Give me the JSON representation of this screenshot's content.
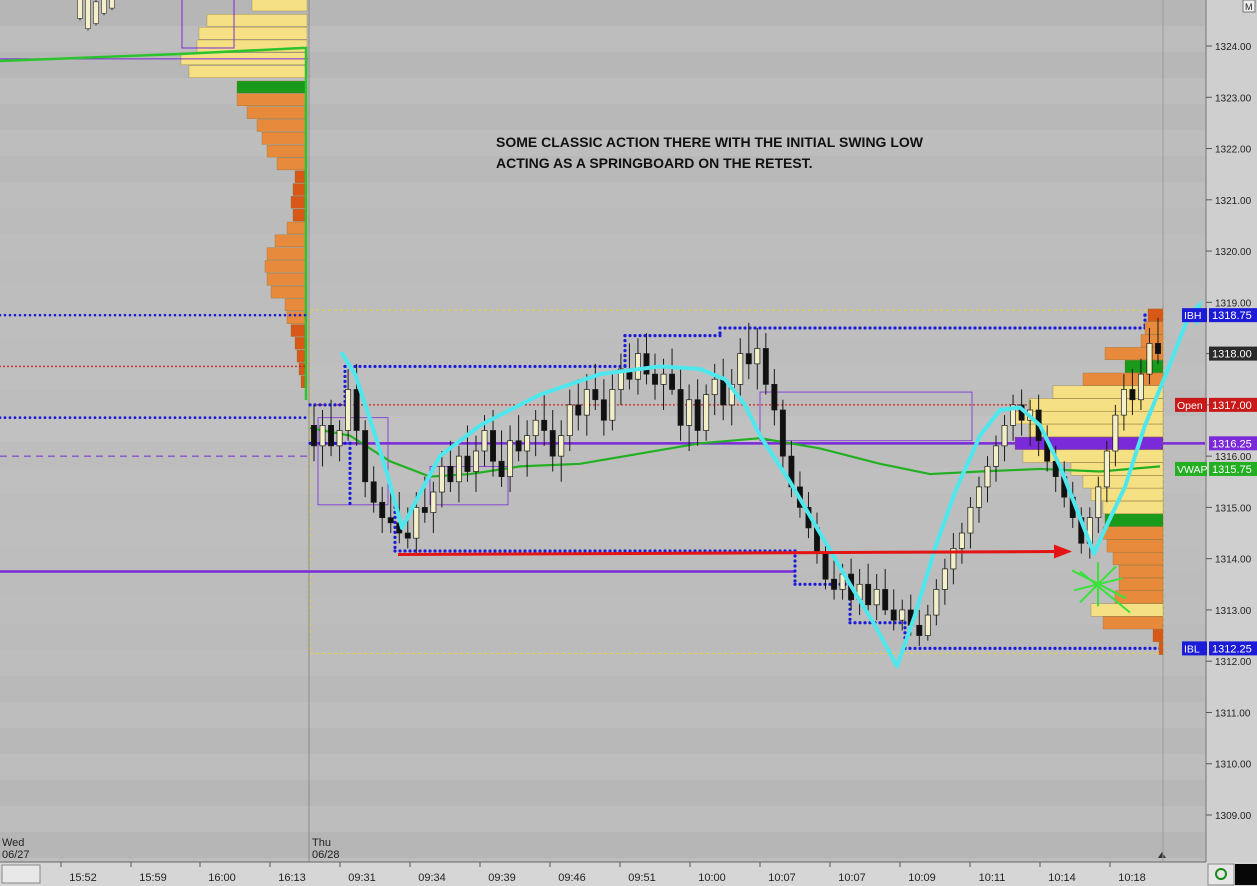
{
  "chart_data": {
    "type": "candlestick",
    "y_axis": {
      "ylim": [
        1308.6,
        1324.6
      ],
      "ticks": [
        "1309.00",
        "1310.00",
        "1311.00",
        "1312.00",
        "1313.00",
        "1314.00",
        "1315.00",
        "1316.00",
        "1317.00",
        "1318.00",
        "1319.00",
        "1320.00",
        "1321.00",
        "1322.00",
        "1323.00",
        "1324.00"
      ],
      "corner_label": "M"
    },
    "x_axis": {
      "session_markers": [
        {
          "day": "Wed",
          "date": "06/27"
        },
        {
          "day": "Thu",
          "date": "06/28"
        }
      ],
      "time_labels": [
        "15:52",
        "15:59",
        "16:00",
        "16:13",
        "09:31",
        "09:34",
        "09:39",
        "09:46",
        "09:51",
        "10:00",
        "10:07",
        "10:07",
        "10:09",
        "10:11",
        "10:14",
        "10:18"
      ]
    },
    "annotation": {
      "line1": "SOME CLASSIC ACTION THERE WITH THE INITIAL SWING LOW",
      "line2": "ACTING AS A SPRINGBOARD ON THE RETEST."
    },
    "price_tags": [
      {
        "text": "IBH",
        "value": "1318.75",
        "price": 1318.75,
        "color": "#1c1cd8"
      },
      {
        "text": "",
        "value": "1318.00",
        "price": 1318.0,
        "color": "#2a2a2a"
      },
      {
        "text": "Open",
        "value": "1317.00",
        "price": 1317.0,
        "color": "#c81818"
      },
      {
        "text": "",
        "value": "1316.25",
        "price": 1316.25,
        "color": "#7a2ad8"
      },
      {
        "text": "VWAP",
        "value": "1315.75",
        "price": 1315.75,
        "color": "#22b022"
      },
      {
        "text": "IBL",
        "value": "1312.25",
        "price": 1312.25,
        "color": "#1c1cd8"
      }
    ],
    "levels": {
      "ibh": 1318.75,
      "ibl": 1312.25,
      "open": 1317.0,
      "purple_line": 1316.25,
      "prior_purple_line": 1313.75,
      "initial_swing_low": 1314.1
    },
    "candles": [
      {
        "o": 1316.6,
        "h": 1317.0,
        "l": 1315.9,
        "c": 1316.2
      },
      {
        "o": 1316.2,
        "h": 1316.9,
        "l": 1315.8,
        "c": 1316.6
      },
      {
        "o": 1316.6,
        "h": 1317.1,
        "l": 1316.0,
        "c": 1316.2
      },
      {
        "o": 1316.2,
        "h": 1316.7,
        "l": 1315.9,
        "c": 1316.5
      },
      {
        "o": 1316.5,
        "h": 1317.7,
        "l": 1316.3,
        "c": 1317.3
      },
      {
        "o": 1317.3,
        "h": 1317.8,
        "l": 1316.2,
        "c": 1316.5
      },
      {
        "o": 1316.5,
        "h": 1316.7,
        "l": 1315.2,
        "c": 1315.5
      },
      {
        "o": 1315.5,
        "h": 1315.8,
        "l": 1314.9,
        "c": 1315.1
      },
      {
        "o": 1315.1,
        "h": 1315.4,
        "l": 1314.5,
        "c": 1314.8
      },
      {
        "o": 1314.8,
        "h": 1315.4,
        "l": 1314.5,
        "c": 1314.7
      },
      {
        "o": 1314.7,
        "h": 1315.3,
        "l": 1314.3,
        "c": 1314.5
      },
      {
        "o": 1314.5,
        "h": 1315.0,
        "l": 1314.2,
        "c": 1314.4
      },
      {
        "o": 1314.4,
        "h": 1315.3,
        "l": 1314.1,
        "c": 1315.0
      },
      {
        "o": 1315.0,
        "h": 1315.6,
        "l": 1314.7,
        "c": 1314.9
      },
      {
        "o": 1314.9,
        "h": 1315.5,
        "l": 1314.5,
        "c": 1315.3
      },
      {
        "o": 1315.3,
        "h": 1316.1,
        "l": 1315.0,
        "c": 1315.8
      },
      {
        "o": 1315.8,
        "h": 1316.3,
        "l": 1315.3,
        "c": 1315.5
      },
      {
        "o": 1315.5,
        "h": 1316.2,
        "l": 1315.1,
        "c": 1316.0
      },
      {
        "o": 1316.0,
        "h": 1316.6,
        "l": 1315.5,
        "c": 1315.7
      },
      {
        "o": 1315.7,
        "h": 1316.4,
        "l": 1315.3,
        "c": 1316.1
      },
      {
        "o": 1316.1,
        "h": 1316.8,
        "l": 1315.8,
        "c": 1316.5
      },
      {
        "o": 1316.5,
        "h": 1316.9,
        "l": 1315.6,
        "c": 1315.9
      },
      {
        "o": 1315.9,
        "h": 1316.5,
        "l": 1315.4,
        "c": 1315.6
      },
      {
        "o": 1315.6,
        "h": 1316.6,
        "l": 1315.3,
        "c": 1316.3
      },
      {
        "o": 1316.3,
        "h": 1316.8,
        "l": 1315.9,
        "c": 1316.1
      },
      {
        "o": 1316.1,
        "h": 1316.7,
        "l": 1315.6,
        "c": 1316.4
      },
      {
        "o": 1316.4,
        "h": 1316.9,
        "l": 1316.0,
        "c": 1316.7
      },
      {
        "o": 1316.7,
        "h": 1317.2,
        "l": 1316.2,
        "c": 1316.5
      },
      {
        "o": 1316.5,
        "h": 1316.9,
        "l": 1315.7,
        "c": 1316.0
      },
      {
        "o": 1316.0,
        "h": 1316.7,
        "l": 1315.5,
        "c": 1316.4
      },
      {
        "o": 1316.4,
        "h": 1317.3,
        "l": 1316.1,
        "c": 1317.0
      },
      {
        "o": 1317.0,
        "h": 1317.5,
        "l": 1316.5,
        "c": 1316.8
      },
      {
        "o": 1316.8,
        "h": 1317.6,
        "l": 1316.4,
        "c": 1317.3
      },
      {
        "o": 1317.3,
        "h": 1317.8,
        "l": 1316.9,
        "c": 1317.1
      },
      {
        "o": 1317.1,
        "h": 1317.5,
        "l": 1316.4,
        "c": 1316.7
      },
      {
        "o": 1316.7,
        "h": 1317.6,
        "l": 1316.5,
        "c": 1317.3
      },
      {
        "o": 1317.3,
        "h": 1318.0,
        "l": 1317.0,
        "c": 1317.7
      },
      {
        "o": 1317.7,
        "h": 1318.2,
        "l": 1317.3,
        "c": 1317.5
      },
      {
        "o": 1317.5,
        "h": 1318.3,
        "l": 1317.2,
        "c": 1318.0
      },
      {
        "o": 1318.0,
        "h": 1318.4,
        "l": 1317.4,
        "c": 1317.6
      },
      {
        "o": 1317.6,
        "h": 1318.0,
        "l": 1317.1,
        "c": 1317.4
      },
      {
        "o": 1317.4,
        "h": 1317.9,
        "l": 1316.9,
        "c": 1317.6
      },
      {
        "o": 1317.6,
        "h": 1318.1,
        "l": 1317.2,
        "c": 1317.3
      },
      {
        "o": 1317.3,
        "h": 1317.7,
        "l": 1316.3,
        "c": 1316.6
      },
      {
        "o": 1316.6,
        "h": 1317.4,
        "l": 1316.1,
        "c": 1317.1
      },
      {
        "o": 1317.1,
        "h": 1317.5,
        "l": 1316.2,
        "c": 1316.5
      },
      {
        "o": 1316.5,
        "h": 1317.4,
        "l": 1316.3,
        "c": 1317.2
      },
      {
        "o": 1317.2,
        "h": 1317.8,
        "l": 1316.8,
        "c": 1317.5
      },
      {
        "o": 1317.5,
        "h": 1317.9,
        "l": 1316.7,
        "c": 1317.0
      },
      {
        "o": 1317.0,
        "h": 1317.7,
        "l": 1316.6,
        "c": 1317.4
      },
      {
        "o": 1317.4,
        "h": 1318.3,
        "l": 1317.1,
        "c": 1318.0
      },
      {
        "o": 1318.0,
        "h": 1318.6,
        "l": 1317.5,
        "c": 1317.8
      },
      {
        "o": 1317.8,
        "h": 1318.5,
        "l": 1317.3,
        "c": 1318.1
      },
      {
        "o": 1318.1,
        "h": 1318.4,
        "l": 1317.2,
        "c": 1317.4
      },
      {
        "o": 1317.4,
        "h": 1317.7,
        "l": 1316.6,
        "c": 1316.9
      },
      {
        "o": 1316.9,
        "h": 1317.1,
        "l": 1315.7,
        "c": 1316.0
      },
      {
        "o": 1316.0,
        "h": 1316.3,
        "l": 1315.2,
        "c": 1315.4
      },
      {
        "o": 1315.4,
        "h": 1315.7,
        "l": 1314.8,
        "c": 1315.0
      },
      {
        "o": 1315.0,
        "h": 1315.3,
        "l": 1314.4,
        "c": 1314.6
      },
      {
        "o": 1314.6,
        "h": 1314.9,
        "l": 1313.9,
        "c": 1314.1
      },
      {
        "o": 1314.1,
        "h": 1314.3,
        "l": 1313.4,
        "c": 1313.6
      },
      {
        "o": 1313.6,
        "h": 1314.1,
        "l": 1313.2,
        "c": 1313.4
      },
      {
        "o": 1313.4,
        "h": 1313.9,
        "l": 1313.2,
        "c": 1313.7
      },
      {
        "o": 1313.7,
        "h": 1314.0,
        "l": 1313.0,
        "c": 1313.2
      },
      {
        "o": 1313.2,
        "h": 1313.8,
        "l": 1312.9,
        "c": 1313.5
      },
      {
        "o": 1313.5,
        "h": 1313.9,
        "l": 1312.9,
        "c": 1313.1
      },
      {
        "o": 1313.1,
        "h": 1313.7,
        "l": 1312.8,
        "c": 1313.4
      },
      {
        "o": 1313.4,
        "h": 1313.8,
        "l": 1312.9,
        "c": 1313.0
      },
      {
        "o": 1313.0,
        "h": 1313.4,
        "l": 1312.6,
        "c": 1312.8
      },
      {
        "o": 1312.8,
        "h": 1313.2,
        "l": 1312.6,
        "c": 1313.0
      },
      {
        "o": 1313.0,
        "h": 1313.3,
        "l": 1312.5,
        "c": 1312.7
      },
      {
        "o": 1312.7,
        "h": 1313.0,
        "l": 1312.3,
        "c": 1312.5
      },
      {
        "o": 1312.5,
        "h": 1313.1,
        "l": 1312.4,
        "c": 1312.9
      },
      {
        "o": 1312.9,
        "h": 1313.6,
        "l": 1312.7,
        "c": 1313.4
      },
      {
        "o": 1313.4,
        "h": 1314.0,
        "l": 1313.1,
        "c": 1313.8
      },
      {
        "o": 1313.8,
        "h": 1314.5,
        "l": 1313.5,
        "c": 1314.2
      },
      {
        "o": 1314.2,
        "h": 1314.7,
        "l": 1313.9,
        "c": 1314.5
      },
      {
        "o": 1314.5,
        "h": 1315.2,
        "l": 1314.2,
        "c": 1315.0
      },
      {
        "o": 1315.0,
        "h": 1315.6,
        "l": 1314.7,
        "c": 1315.4
      },
      {
        "o": 1315.4,
        "h": 1316.0,
        "l": 1315.1,
        "c": 1315.8
      },
      {
        "o": 1315.8,
        "h": 1316.4,
        "l": 1315.5,
        "c": 1316.2
      },
      {
        "o": 1316.2,
        "h": 1316.8,
        "l": 1315.9,
        "c": 1316.6
      },
      {
        "o": 1316.6,
        "h": 1317.2,
        "l": 1316.3,
        "c": 1317.0
      },
      {
        "o": 1317.0,
        "h": 1317.3,
        "l": 1316.4,
        "c": 1316.7
      },
      {
        "o": 1316.7,
        "h": 1317.1,
        "l": 1316.2,
        "c": 1316.9
      },
      {
        "o": 1316.9,
        "h": 1317.2,
        "l": 1316.0,
        "c": 1316.3
      },
      {
        "o": 1316.3,
        "h": 1316.6,
        "l": 1315.7,
        "c": 1315.9
      },
      {
        "o": 1315.9,
        "h": 1316.2,
        "l": 1315.3,
        "c": 1315.6
      },
      {
        "o": 1315.6,
        "h": 1315.9,
        "l": 1315.0,
        "c": 1315.2
      },
      {
        "o": 1315.2,
        "h": 1315.5,
        "l": 1314.6,
        "c": 1314.8
      },
      {
        "o": 1314.8,
        "h": 1315.0,
        "l": 1314.1,
        "c": 1314.3
      },
      {
        "o": 1314.3,
        "h": 1315.0,
        "l": 1314.0,
        "c": 1314.8
      },
      {
        "o": 1314.8,
        "h": 1315.6,
        "l": 1314.5,
        "c": 1315.4
      },
      {
        "o": 1315.4,
        "h": 1316.3,
        "l": 1315.1,
        "c": 1316.1
      },
      {
        "o": 1316.1,
        "h": 1317.0,
        "l": 1315.8,
        "c": 1316.8
      },
      {
        "o": 1316.8,
        "h": 1317.6,
        "l": 1316.5,
        "c": 1317.3
      },
      {
        "o": 1317.3,
        "h": 1317.7,
        "l": 1316.8,
        "c": 1317.1
      },
      {
        "o": 1317.1,
        "h": 1317.9,
        "l": 1316.9,
        "c": 1317.6
      },
      {
        "o": 1317.6,
        "h": 1318.5,
        "l": 1317.4,
        "c": 1318.2
      },
      {
        "o": 1318.2,
        "h": 1318.7,
        "l": 1317.8,
        "c": 1318.0
      }
    ]
  },
  "colors": {
    "background": "#bdbdbd",
    "grid": "#a9a9a9",
    "ibh_ibl": "#1c1cd8",
    "open": "#c81818",
    "purple": "#7a2ad8",
    "vwap": "#22b022",
    "cyan_drawing": "#4fe7ee",
    "red_arrow": "#e41414",
    "profile_yellow": "#f5e184",
    "profile_orange": "#e88a3c",
    "profile_red": "#d85818",
    "profile_green": "#1a9a1a",
    "annotation_text": "#111111"
  }
}
